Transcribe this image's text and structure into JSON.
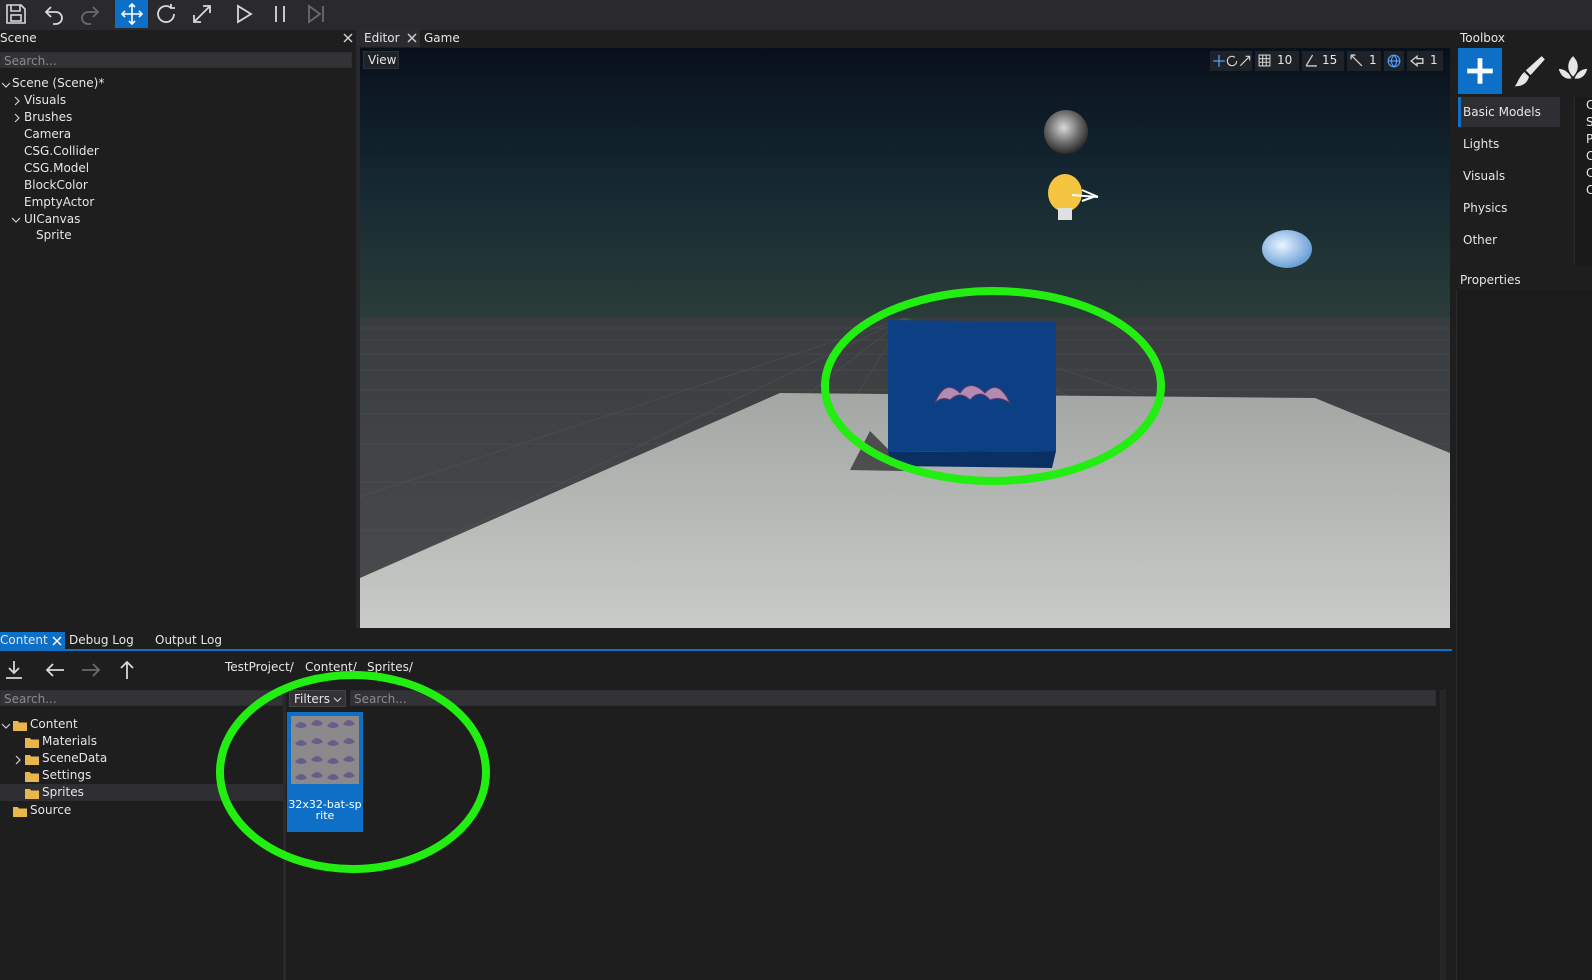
{
  "toolbar": {
    "icons": [
      "save-icon",
      "undo-icon",
      "redo-icon",
      "move-icon",
      "rotate-icon",
      "scale-icon",
      "play-icon",
      "pause-icon",
      "step-icon"
    ]
  },
  "scene_panel": {
    "title": "Scene",
    "search_placeholder": "Search...",
    "root": "Scene (Scene)*",
    "items": [
      "Visuals",
      "Brushes",
      "Camera",
      "CSG.Collider",
      "CSG.Model",
      "BlockColor",
      "EmptyActor",
      "UICanvas",
      "Sprite"
    ]
  },
  "editor_tabs": {
    "editor": "Editor",
    "game": "Game"
  },
  "viewport": {
    "view_button": "View",
    "grid_snap": "10",
    "angle_snap": "15",
    "scale_snap": "1",
    "cam_speed": "1"
  },
  "toolbox": {
    "title": "Toolbox",
    "categories": [
      "Basic Models",
      "Lights",
      "Visuals",
      "Physics",
      "Other"
    ],
    "right_letters": [
      "C",
      "S",
      "P",
      "C",
      "C",
      "C"
    ]
  },
  "properties": {
    "title": "Properties"
  },
  "bottom_tabs": {
    "content": "Content",
    "debug_log": "Debug Log",
    "output_log": "Output Log"
  },
  "content_panel": {
    "breadcrumb": [
      "TestProject/",
      "Content/",
      "Sprites/"
    ],
    "tree_search_placeholder": "Search...",
    "filters_label": "Filters",
    "asset_search_placeholder": "Search...",
    "tree": {
      "root": "Content",
      "children": [
        "Materials",
        "SceneData",
        "Settings",
        "Sprites"
      ],
      "source": "Source"
    },
    "asset": {
      "name": "32x32-bat-sprite"
    }
  },
  "colors": {
    "accent": "#0e6fc7",
    "annotation": "#22ee11",
    "panel_bg": "#1e1e1e",
    "toolbar_bg": "#2a2a2e"
  }
}
